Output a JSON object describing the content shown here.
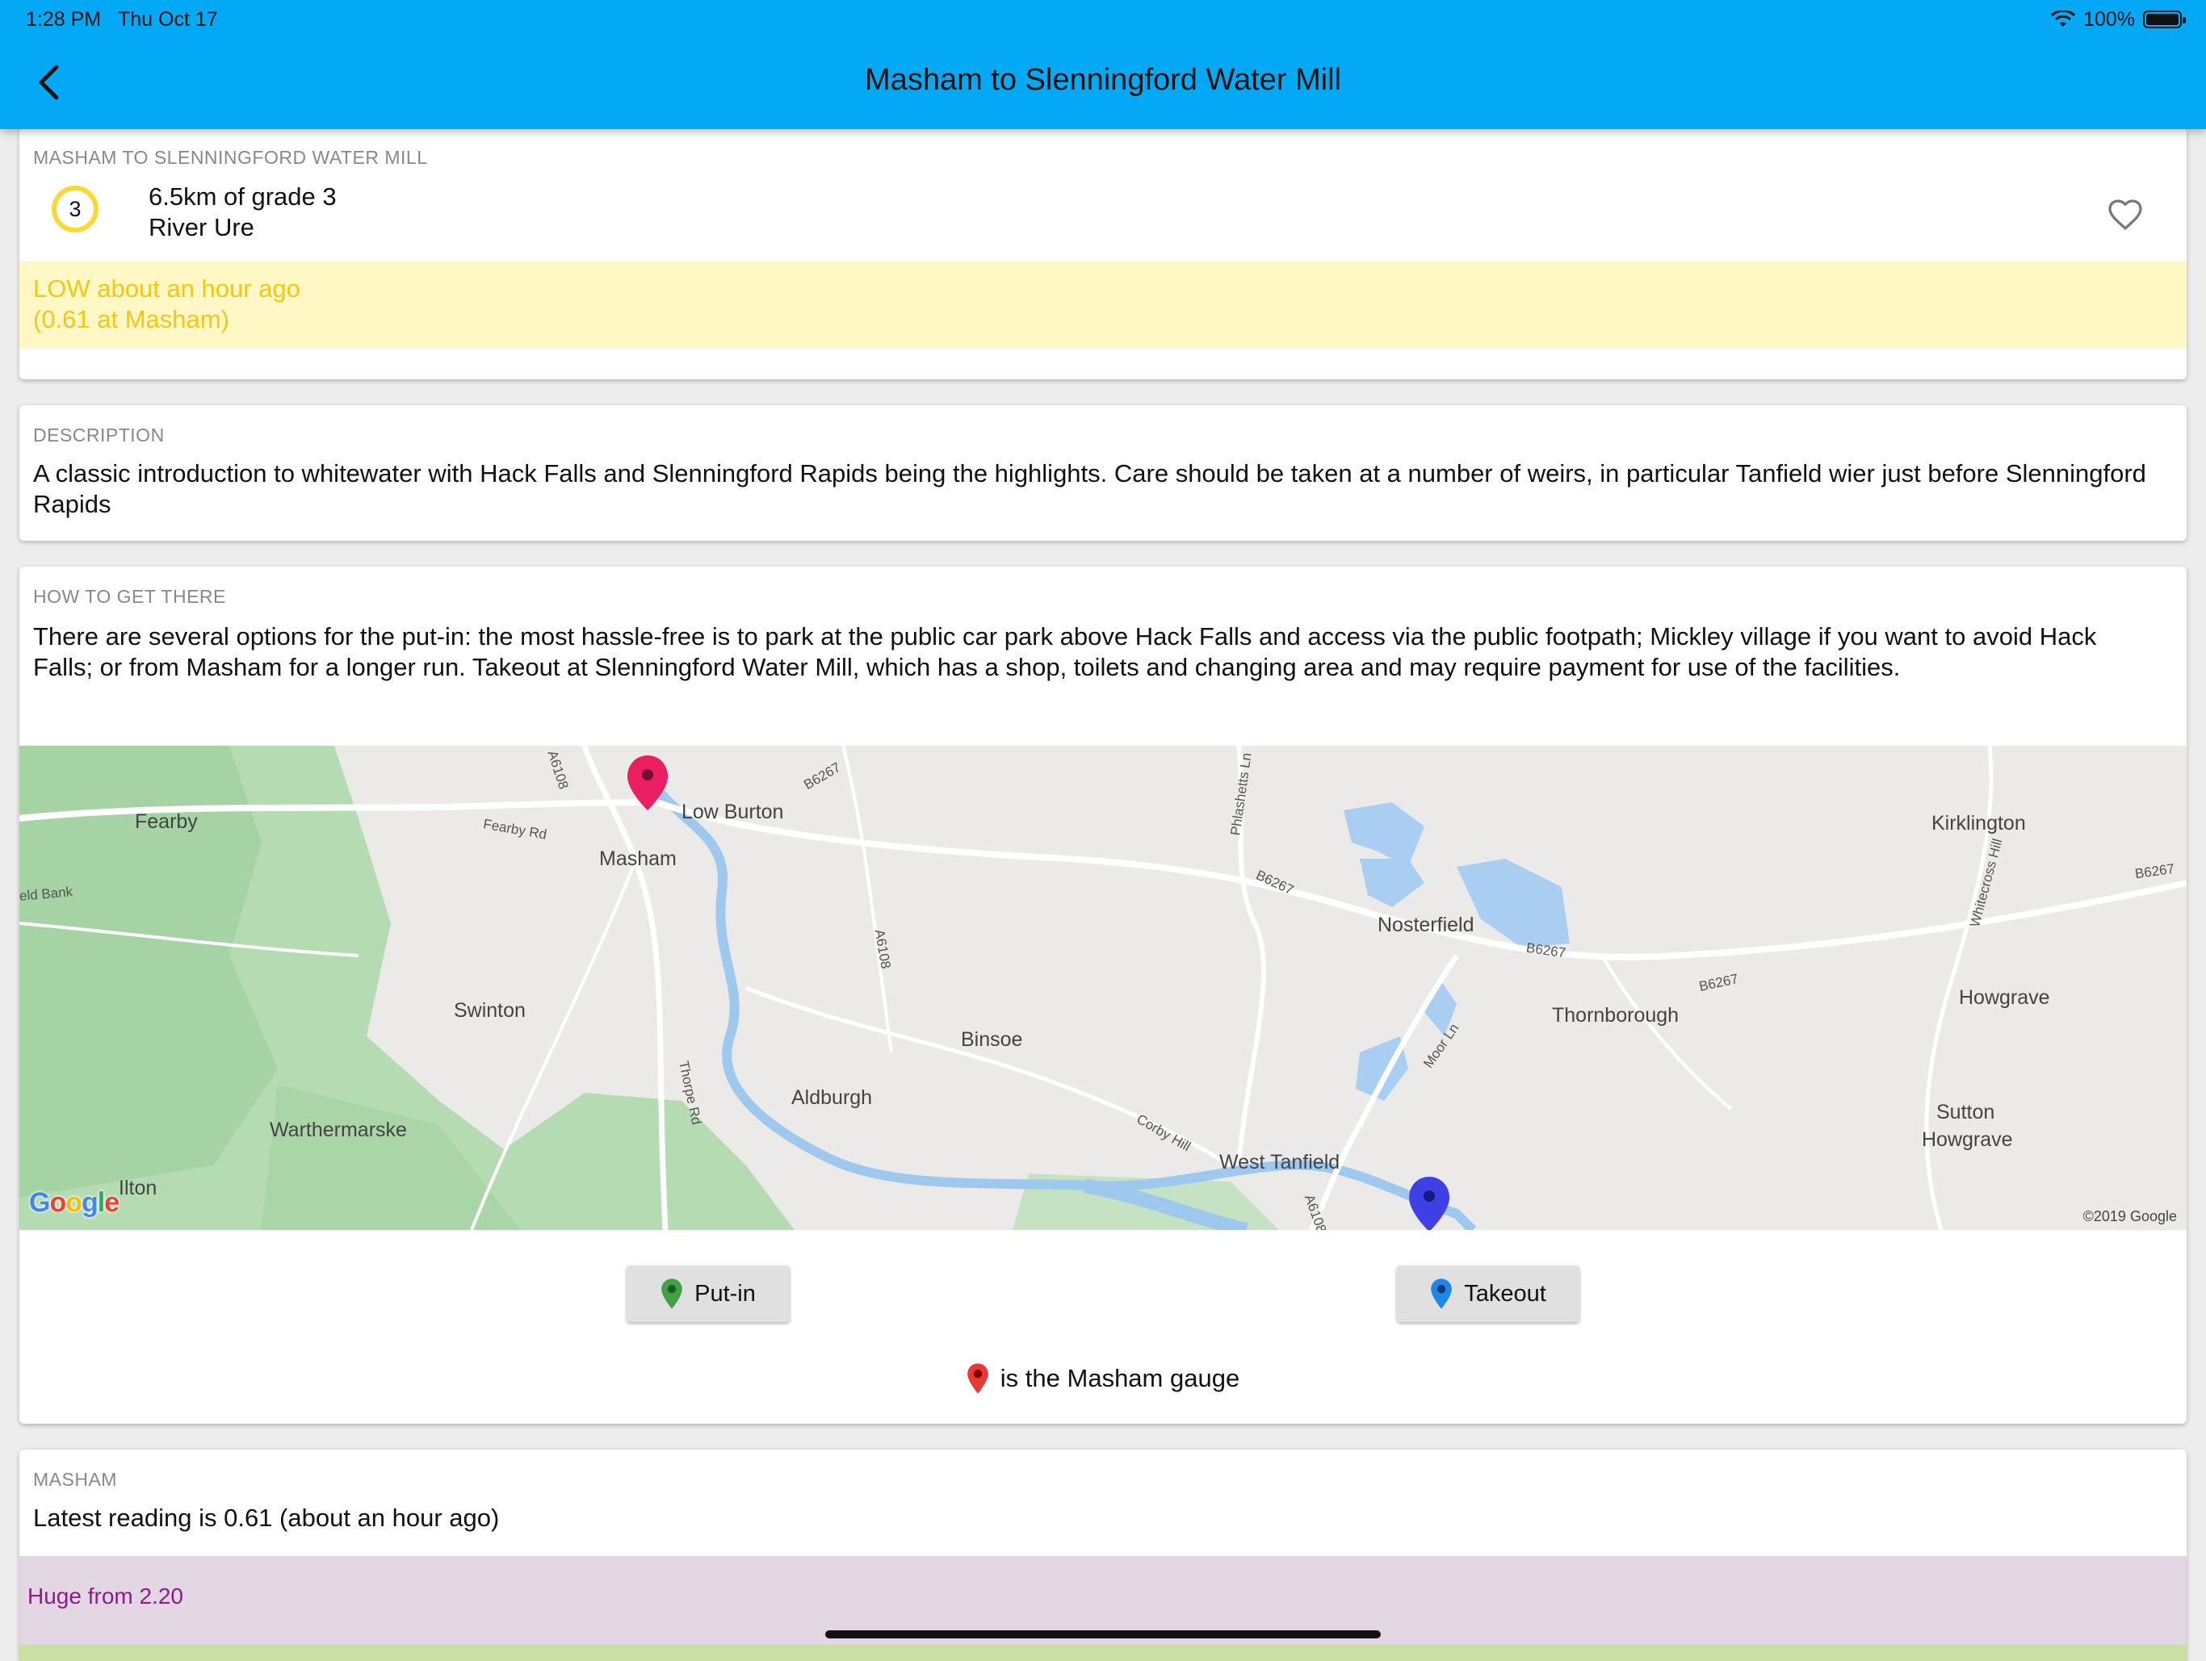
{
  "status_bar": {
    "time": "1:28 PM",
    "date": "Thu Oct 17",
    "battery": "100%",
    "battery_level": 1.0
  },
  "header": {
    "title": "Masham to Slenningford Water Mill"
  },
  "summary": {
    "overline": "MASHAM TO SLENNINGFORD WATER MILL",
    "grade": "3",
    "distance_grade": "6.5km of grade 3",
    "river": "River Ure",
    "level_line1": "LOW about an hour ago",
    "level_line2": "(0.61 at Masham)"
  },
  "description": {
    "overline": "DESCRIPTION",
    "text": "A classic introduction to whitewater with Hack Falls and Slenningford Rapids being the highlights. Care should be taken at a number of weirs, in particular Tanfield wier just before Slenningford Rapids"
  },
  "directions": {
    "overline": "HOW TO GET THERE",
    "text": "There are several options for the put-in: the most hassle-free is to park at the public car park above Hack Falls and access via the public footpath; Mickley village if you want to avoid Hack Falls; or from Masham for a longer run. Takeout at Slenningford Water Mill, which has a shop, toilets and changing area and may require payment for use of the facilities.",
    "put_in_label": "Put-in",
    "takeout_label": "Takeout",
    "gauge_note": "is the Masham gauge"
  },
  "map": {
    "places": [
      "Fearby",
      "Low Burton",
      "Masham",
      "Swinton",
      "Warthermarske",
      "Ilton",
      "Binsoe",
      "Aldburgh",
      "West Tanfield",
      "Nosterfield",
      "Thornborough",
      "Kirklington",
      "Howgrave",
      "Sutton",
      "Howgrave"
    ],
    "roads": [
      "A6108",
      "B6267",
      "Fearby Rd",
      "eld Bank",
      "A6108",
      "Thorpe Rd",
      "Phlashetts Ln",
      "B6267",
      "B6267",
      "B6267",
      "Moor Ln",
      "Corby Hill",
      "A6108",
      "Whitecross Hill",
      "B6267"
    ],
    "logo": "Google",
    "copyright": "©2019 Google"
  },
  "gauge": {
    "overline": "MASHAM",
    "latest": "Latest reading is 0.61 (about an hour ago)",
    "huge": "Huge from 2.20"
  },
  "colors": {
    "app_bar": "#03a9f4",
    "grade_ring": "#fdd835",
    "low_text": "#f5c518",
    "low_band": "#fff8c4",
    "huge_band": "#e1d6e1",
    "huge_text": "#8e1a8e",
    "put_in_pin": "#43a047",
    "takeout_pin": "#1e88e5",
    "gauge_pin": "#e53935",
    "map_put_in_marker": "#e91e63",
    "map_takeout_marker": "#3f3fe6"
  }
}
